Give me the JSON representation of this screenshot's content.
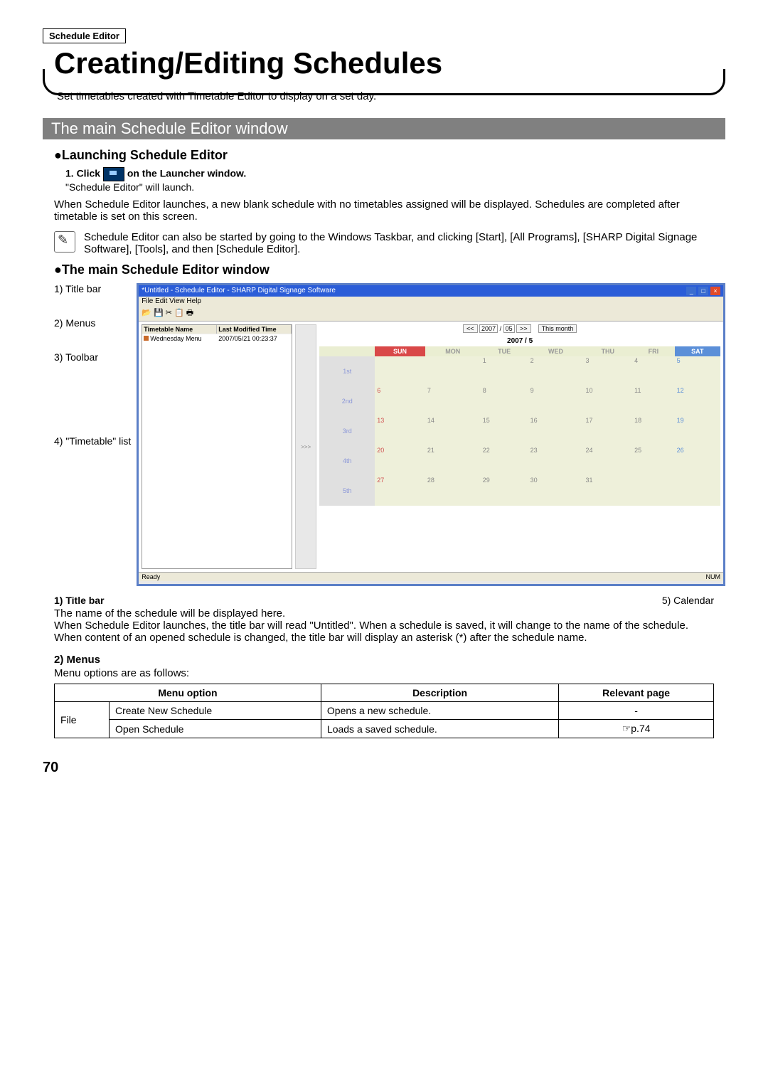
{
  "header_box": "Schedule Editor",
  "page_title": "Creating/Editing Schedules",
  "intro": "Set timetables created with Timetable Editor to display on a set day.",
  "section_bar": "The main Schedule Editor window",
  "sub1": "●Launching Schedule Editor",
  "step1a": "1.  Click",
  "step1b": "on the Launcher window.",
  "step1_result": "\"Schedule Editor\" will launch.",
  "para1": "When Schedule Editor launches, a new blank schedule with no timetables assigned will be displayed. Schedules are completed after timetable is set on this screen.",
  "note": "Schedule Editor can also be started by going to the Windows Taskbar, and clicking [Start], [All Programs], [SHARP Digital Signage Software], [Tools], and then [Schedule Editor].",
  "sub2": "●The main Schedule Editor window",
  "labels": {
    "l1": "1) Title bar",
    "l2": "2) Menus",
    "l3": "3) Toolbar",
    "l4": "4) \"Timetable\" list",
    "l5": "5) Calendar"
  },
  "scr": {
    "title": "Untitled - Schedule Editor - SHARP Digital Signage Software",
    "asterisk": "*",
    "menu": "File   Edit   View   Help",
    "toolbar_icons": "📂 💾  ✂ 📋 🖶",
    "left_h1": "Timetable Name",
    "left_h2": "Last Modified Time",
    "left_r1": "Wednesday Menu",
    "left_r2": "2007/05/21 00:23:37",
    "mid": ">>>",
    "nav_prev": "<<",
    "nav_year": "2007",
    "nav_slash": "/",
    "nav_month": "05",
    "nav_next": ">>",
    "nav_this": "This month",
    "cal_title": "2007 / 5",
    "days": [
      "SUN",
      "MON",
      "TUE",
      "WED",
      "THU",
      "FRI",
      "SAT"
    ],
    "weeks": [
      "1st",
      "2nd",
      "3rd",
      "4th",
      "5th"
    ],
    "status_l": "Ready",
    "status_r": "NUM"
  },
  "below_l": "1) Title bar",
  "below_r": "5) Calendar",
  "title_bar_text": "The name of the schedule will be displayed here.\nWhen Schedule Editor launches, the title bar will read \"Untitled\". When a schedule is saved, it will change to the name of the schedule. When content of an opened schedule is changed, the title bar will display an asterisk (*) after the schedule name.",
  "menus_h": "2) Menus",
  "menus_intro": "Menu options are as follows:",
  "table": {
    "h1": "Menu option",
    "h2": "Description",
    "h3": "Relevant page",
    "r1c1": "File",
    "r1c2": "Create New Schedule",
    "r1c3": "Opens a new schedule.",
    "r1c4": "-",
    "r2c2": "Open Schedule",
    "r2c3": "Loads a saved schedule.",
    "r2c4": "☞p.74"
  },
  "page_num": "70",
  "chart_data": {
    "type": "table",
    "calendar_year": 2007,
    "calendar_month": 5,
    "day_headers": [
      "SUN",
      "MON",
      "TUE",
      "WED",
      "THU",
      "FRI",
      "SAT"
    ],
    "week_labels": [
      "1st",
      "2nd",
      "3rd",
      "4th",
      "5th"
    ],
    "grid": [
      [
        "",
        "",
        "1",
        "2",
        "3",
        "4",
        "5"
      ],
      [
        "6",
        "7",
        "8",
        "9",
        "10",
        "11",
        "12"
      ],
      [
        "13",
        "14",
        "15",
        "16",
        "17",
        "18",
        "19"
      ],
      [
        "20",
        "21",
        "22",
        "23",
        "24",
        "25",
        "26"
      ],
      [
        "27",
        "28",
        "29",
        "30",
        "31",
        "",
        ""
      ]
    ]
  }
}
